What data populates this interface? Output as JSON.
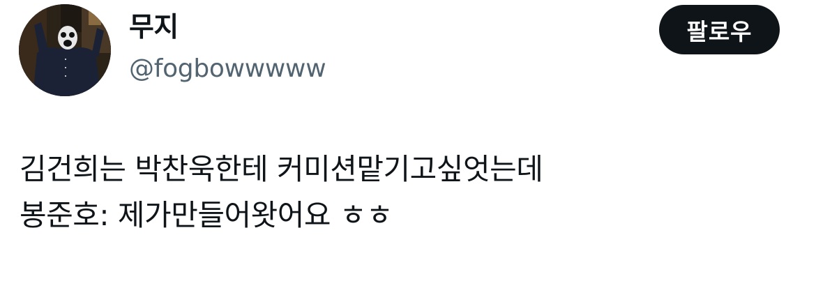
{
  "author": {
    "display_name": "무지",
    "handle": "@fogbowwwww",
    "avatar_icon": "profile-photo"
  },
  "follow_button": {
    "label": "팔로우"
  },
  "tweet": {
    "lines": [
      "김건희는 박찬욱한테 커미션맡기고싶엇는데",
      "봉준호: 제가만들어왓어요 ㅎㅎ"
    ]
  },
  "colors": {
    "text": "#0f1419",
    "secondary_text": "#536471",
    "button_bg": "#0f1419",
    "button_text": "#ffffff",
    "background": "#ffffff"
  }
}
